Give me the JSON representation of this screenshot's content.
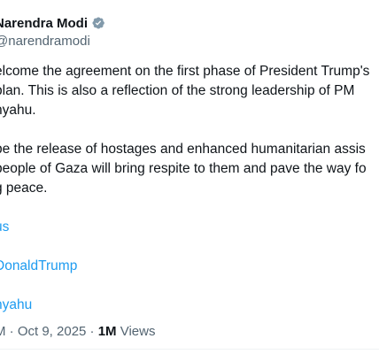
{
  "author": {
    "display_name": "Narendra Modi",
    "handle": "@narendramodi",
    "verified_icon": "verified-badge-gray-icon",
    "badge_color": "#829aab"
  },
  "body": {
    "paragraph_1": [
      "elcome the agreement on the first phase of President Trump's",
      "plan. This is also a reflection of the strong leadership of PM",
      "nyahu."
    ],
    "paragraph_2": [
      "pe the release of hostages and enhanced humanitarian assis",
      "people of Gaza will bring respite to them and pave the way fo",
      "g peace."
    ],
    "mentions": [
      "us",
      "DonaldTrump",
      "nyahu"
    ]
  },
  "meta": {
    "time_prefix": "M · Oct 9, 2025 · ",
    "views_count": "1M",
    "views_label": " Views"
  },
  "colors": {
    "text": "#0f1419",
    "secondary": "#536471",
    "link": "#1d9bf0"
  }
}
